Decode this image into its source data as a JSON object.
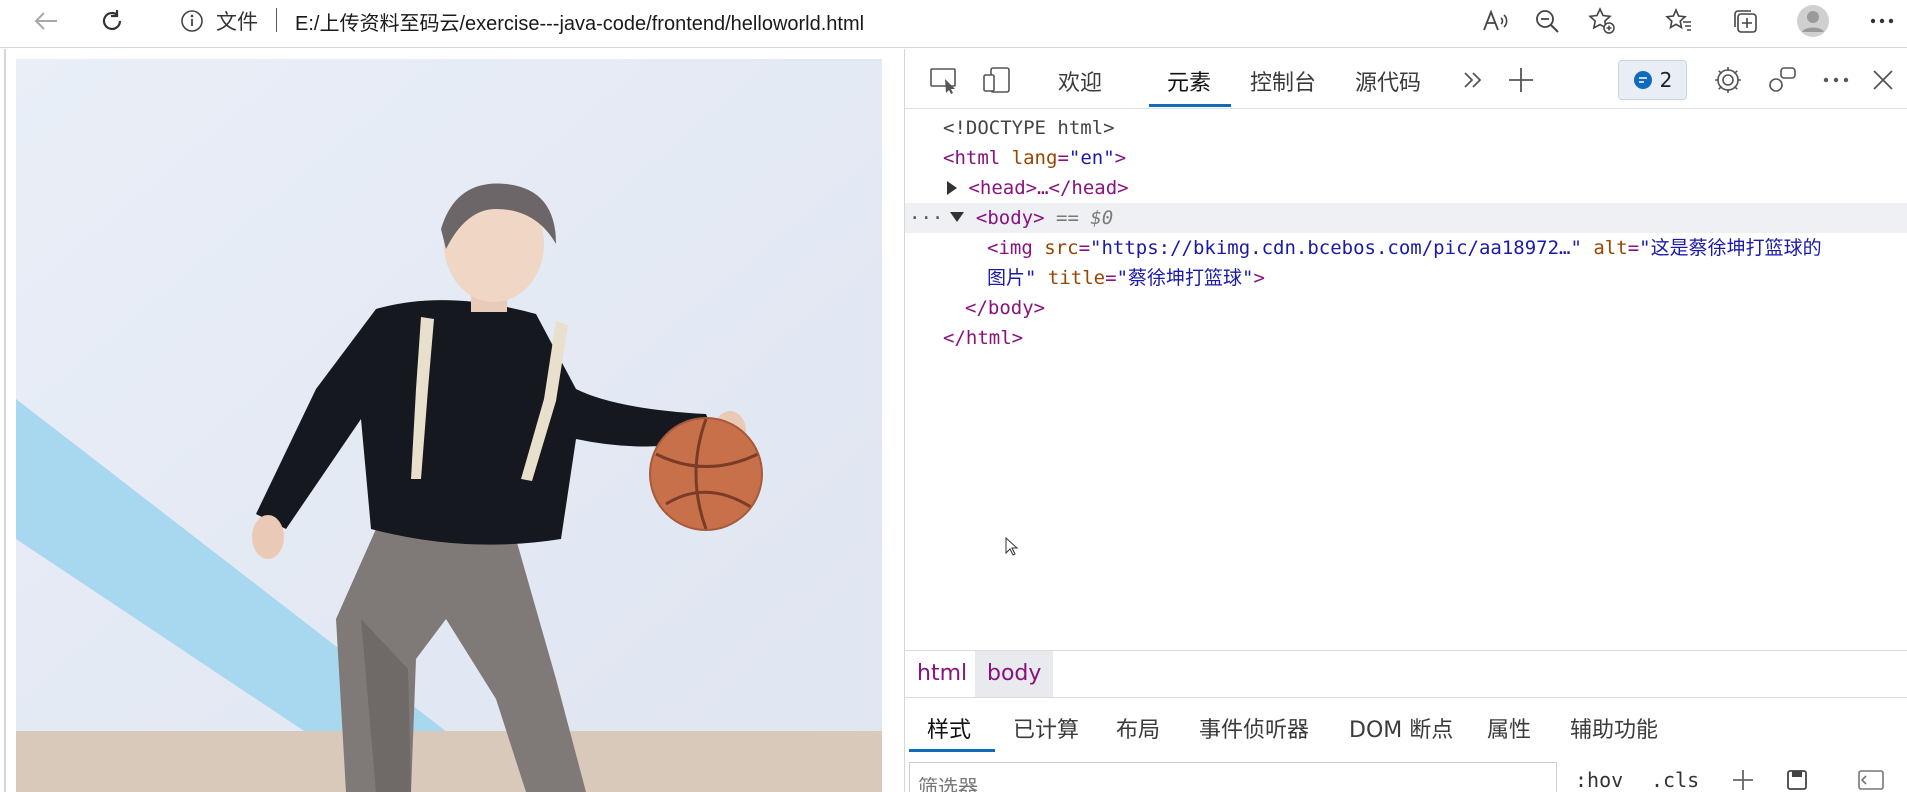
{
  "browser": {
    "info_label": "文件",
    "url": "E:/上传资料至码云/exercise---java-code/frontend/helloworld.html"
  },
  "photo": {
    "alt": "这是蔡徐坤打篮球的图片",
    "title": "蔡徐坤打篮球"
  },
  "devtools": {
    "tabs": [
      "欢迎",
      "元素",
      "控制台",
      "源代码"
    ],
    "issues_count": "2",
    "dom": {
      "doctype": "<!DOCTYPE html>",
      "html_open_tag": "html",
      "html_attr": "lang",
      "html_attr_val": "\"en\"",
      "head_collapsed": "<head>…</head>",
      "body_tag": "body",
      "body_selected_hint": "== $0",
      "img_tag": "img",
      "img_src_attr": "src",
      "img_src_val": "\"https://bkimg.cdn.bcebos.com/pic/aa18972…\"",
      "img_alt_attr": "alt",
      "img_alt_val_1": "\"这是蔡徐坤打篮球的",
      "img_alt_val_2": "图片\"",
      "img_title_attr": "title",
      "img_title_val": "\"蔡徐坤打篮球\"",
      "body_close": "</body>",
      "html_close": "</html>"
    },
    "breadcrumbs": [
      "html",
      "body"
    ],
    "styles_tabs": [
      "样式",
      "已计算",
      "布局",
      "事件侦听器",
      "DOM 断点",
      "属性",
      "辅助功能"
    ],
    "filter_placeholder": "筛选器",
    "filter_options": [
      ":hov",
      ".cls"
    ]
  },
  "colors": {
    "accent": "#0f6cbd",
    "tag": "#881280",
    "attribute": "#994500",
    "attribute_value": "#1a1aa6"
  }
}
